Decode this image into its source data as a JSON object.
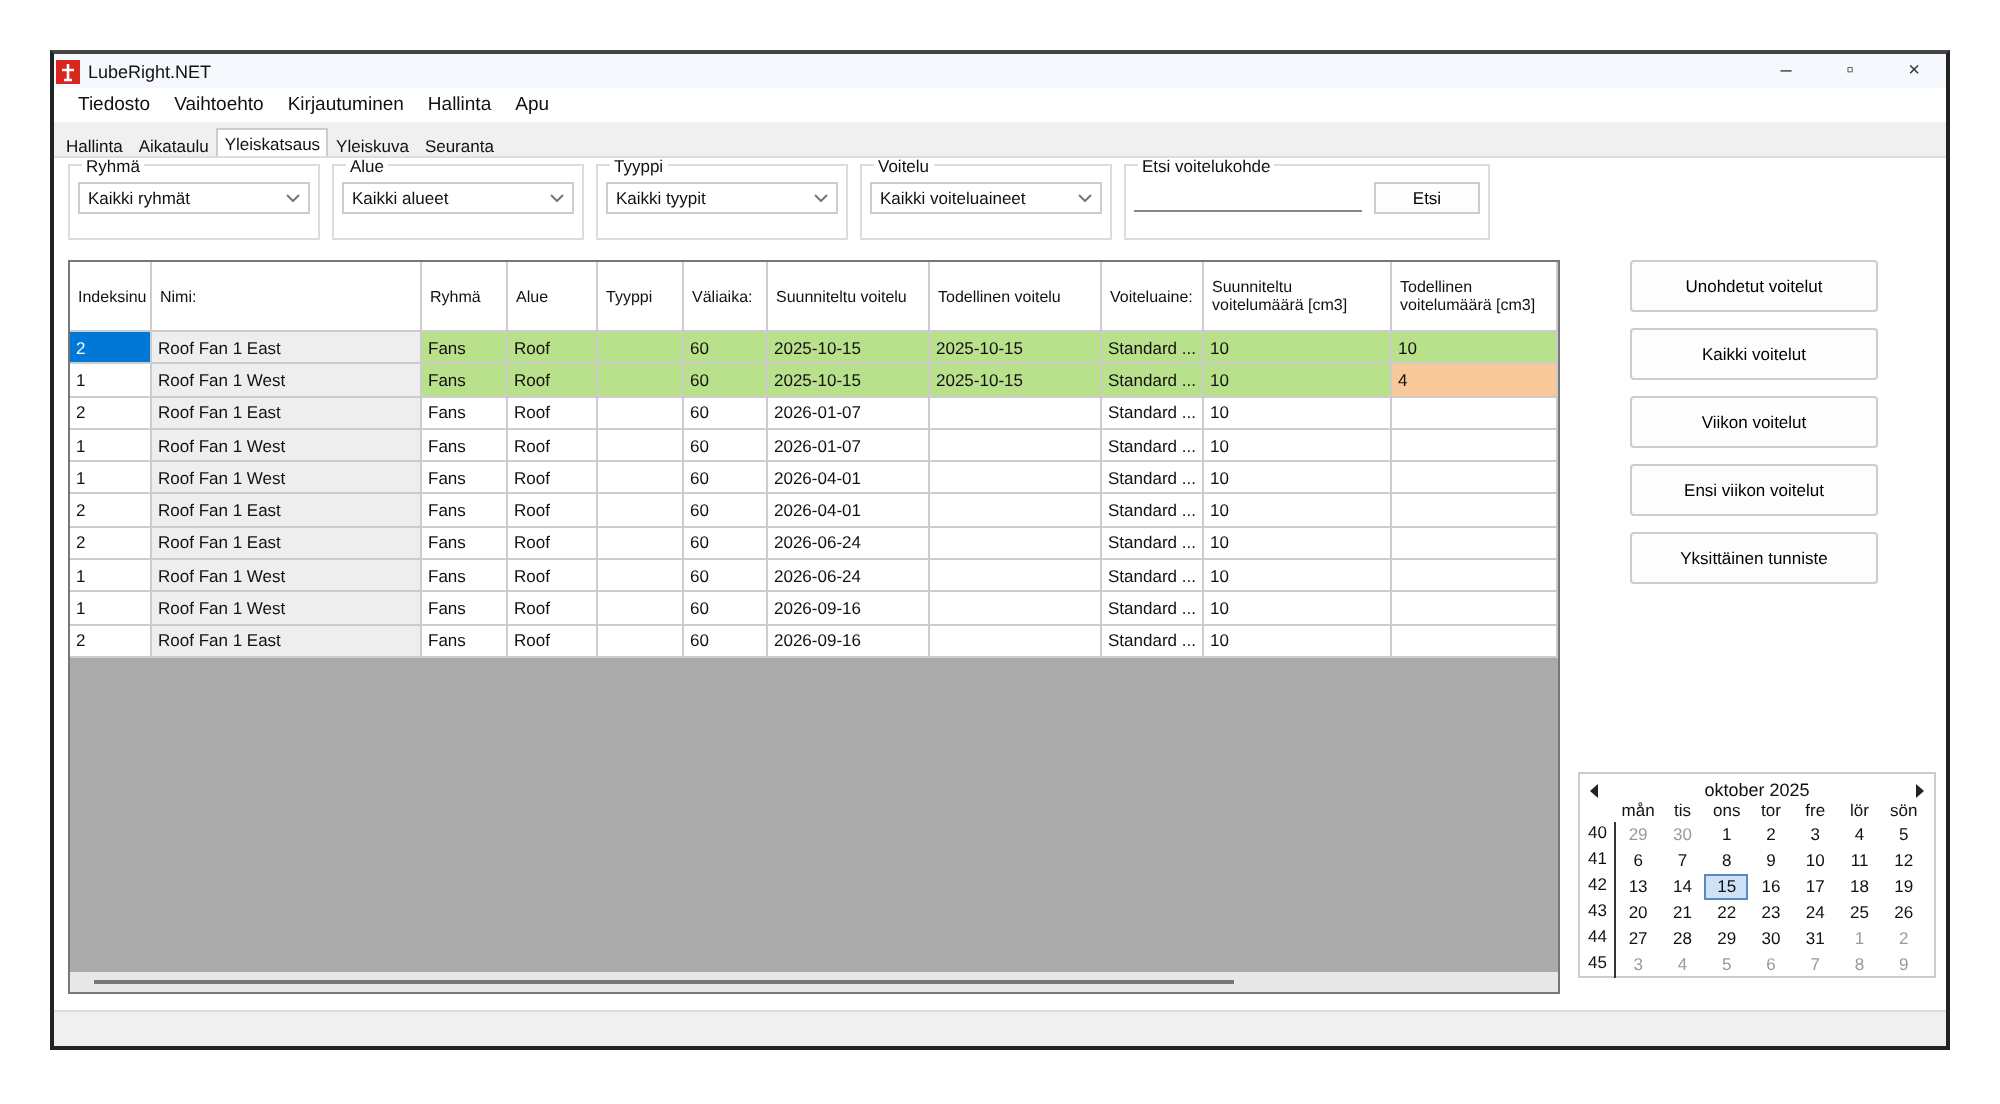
{
  "window": {
    "title": "LubeRight.NET",
    "controls": [
      "–",
      "▫",
      "×"
    ]
  },
  "menu": [
    "Tiedosto",
    "Vaihtoehto",
    "Kirjautuminen",
    "Hallinta",
    "Apu"
  ],
  "tabs": [
    {
      "label": "Hallinta",
      "selected": false
    },
    {
      "label": "Aikataulu",
      "selected": false
    },
    {
      "label": "Yleiskatsaus",
      "selected": true
    },
    {
      "label": "Yleiskuva",
      "selected": false
    },
    {
      "label": "Seuranta",
      "selected": false
    }
  ],
  "filters": [
    {
      "label": "Ryhmä",
      "value": "Kaikki ryhmät"
    },
    {
      "label": "Alue",
      "value": "Kaikki alueet"
    },
    {
      "label": "Tyyppi",
      "value": "Kaikki tyypit"
    },
    {
      "label": "Voitelu",
      "value": "Kaikki voiteluaineet"
    }
  ],
  "search": {
    "label": "Etsi voitelukohde",
    "button": "Etsi"
  },
  "table": {
    "columns": [
      "Indeksinu",
      "Nimi:",
      "Ryhmä",
      "Alue",
      "Tyyppi",
      "Väliaika:",
      "Suunniteltu voitelu",
      "Todellinen voitelu",
      "Voiteluaine:",
      "Suunniteltu voitelumäärä [cm3]",
      "Todellinen voitelumäärä [cm3]"
    ],
    "rows": [
      {
        "cells": [
          "2",
          "Roof Fan 1 East",
          "Fans",
          "Roof",
          "",
          "60",
          "2025-10-15",
          "2025-10-15",
          "Standard ...",
          "10",
          "10"
        ],
        "done": true,
        "amount_low": false,
        "selected": true
      },
      {
        "cells": [
          "1",
          "Roof Fan 1 West",
          "Fans",
          "Roof",
          "",
          "60",
          "2025-10-15",
          "2025-10-15",
          "Standard ...",
          "10",
          "4"
        ],
        "done": true,
        "amount_low": true,
        "selected": false
      },
      {
        "cells": [
          "2",
          "Roof Fan 1 East",
          "Fans",
          "Roof",
          "",
          "60",
          "2026-01-07",
          "",
          "Standard ...",
          "10",
          ""
        ],
        "done": false,
        "amount_low": false,
        "selected": false
      },
      {
        "cells": [
          "1",
          "Roof Fan 1 West",
          "Fans",
          "Roof",
          "",
          "60",
          "2026-01-07",
          "",
          "Standard ...",
          "10",
          ""
        ],
        "done": false,
        "amount_low": false,
        "selected": false
      },
      {
        "cells": [
          "1",
          "Roof Fan 1 West",
          "Fans",
          "Roof",
          "",
          "60",
          "2026-04-01",
          "",
          "Standard ...",
          "10",
          ""
        ],
        "done": false,
        "amount_low": false,
        "selected": false
      },
      {
        "cells": [
          "2",
          "Roof Fan 1 East",
          "Fans",
          "Roof",
          "",
          "60",
          "2026-04-01",
          "",
          "Standard ...",
          "10",
          ""
        ],
        "done": false,
        "amount_low": false,
        "selected": false
      },
      {
        "cells": [
          "2",
          "Roof Fan 1 East",
          "Fans",
          "Roof",
          "",
          "60",
          "2026-06-24",
          "",
          "Standard ...",
          "10",
          ""
        ],
        "done": false,
        "amount_low": false,
        "selected": false
      },
      {
        "cells": [
          "1",
          "Roof Fan 1 West",
          "Fans",
          "Roof",
          "",
          "60",
          "2026-06-24",
          "",
          "Standard ...",
          "10",
          ""
        ],
        "done": false,
        "amount_low": false,
        "selected": false
      },
      {
        "cells": [
          "1",
          "Roof Fan 1 West",
          "Fans",
          "Roof",
          "",
          "60",
          "2026-09-16",
          "",
          "Standard ...",
          "10",
          ""
        ],
        "done": false,
        "amount_low": false,
        "selected": false
      },
      {
        "cells": [
          "2",
          "Roof Fan 1 East",
          "Fans",
          "Roof",
          "",
          "60",
          "2026-09-16",
          "",
          "Standard ...",
          "10",
          ""
        ],
        "done": false,
        "amount_low": false,
        "selected": false
      }
    ]
  },
  "actions": [
    "Unohdetut voitelut",
    "Kaikki voitelut",
    "Viikon voitelut",
    "Ensi viikon voitelut",
    "Yksittäinen tunniste"
  ],
  "calendar": {
    "month": "oktober 2025",
    "weekdays": [
      "mån",
      "tis",
      "ons",
      "tor",
      "fre",
      "lör",
      "sön"
    ],
    "weeks": [
      {
        "week": "40",
        "days": [
          {
            "d": "29",
            "other": true,
            "selected": false
          },
          {
            "d": "30",
            "other": true,
            "selected": false
          },
          {
            "d": "1",
            "other": false,
            "selected": false
          },
          {
            "d": "2",
            "other": false,
            "selected": false
          },
          {
            "d": "3",
            "other": false,
            "selected": false
          },
          {
            "d": "4",
            "other": false,
            "selected": false
          },
          {
            "d": "5",
            "other": false,
            "selected": false
          }
        ]
      },
      {
        "week": "41",
        "days": [
          {
            "d": "6",
            "other": false,
            "selected": false
          },
          {
            "d": "7",
            "other": false,
            "selected": false
          },
          {
            "d": "8",
            "other": false,
            "selected": false
          },
          {
            "d": "9",
            "other": false,
            "selected": false
          },
          {
            "d": "10",
            "other": false,
            "selected": false
          },
          {
            "d": "11",
            "other": false,
            "selected": false
          },
          {
            "d": "12",
            "other": false,
            "selected": false
          }
        ]
      },
      {
        "week": "42",
        "days": [
          {
            "d": "13",
            "other": false,
            "selected": false
          },
          {
            "d": "14",
            "other": false,
            "selected": false
          },
          {
            "d": "15",
            "other": false,
            "selected": true
          },
          {
            "d": "16",
            "other": false,
            "selected": false
          },
          {
            "d": "17",
            "other": false,
            "selected": false
          },
          {
            "d": "18",
            "other": false,
            "selected": false
          },
          {
            "d": "19",
            "other": false,
            "selected": false
          }
        ]
      },
      {
        "week": "43",
        "days": [
          {
            "d": "20",
            "other": false,
            "selected": false
          },
          {
            "d": "21",
            "other": false,
            "selected": false
          },
          {
            "d": "22",
            "other": false,
            "selected": false
          },
          {
            "d": "23",
            "other": false,
            "selected": false
          },
          {
            "d": "24",
            "other": false,
            "selected": false
          },
          {
            "d": "25",
            "other": false,
            "selected": false
          },
          {
            "d": "26",
            "other": false,
            "selected": false
          }
        ]
      },
      {
        "week": "44",
        "days": [
          {
            "d": "27",
            "other": false,
            "selected": false
          },
          {
            "d": "28",
            "other": false,
            "selected": false
          },
          {
            "d": "29",
            "other": false,
            "selected": false
          },
          {
            "d": "30",
            "other": false,
            "selected": false
          },
          {
            "d": "31",
            "other": false,
            "selected": false
          },
          {
            "d": "1",
            "other": true,
            "selected": false
          },
          {
            "d": "2",
            "other": true,
            "selected": false
          }
        ]
      },
      {
        "week": "45",
        "days": [
          {
            "d": "3",
            "other": true,
            "selected": false
          },
          {
            "d": "4",
            "other": true,
            "selected": false
          },
          {
            "d": "5",
            "other": true,
            "selected": false
          },
          {
            "d": "6",
            "other": true,
            "selected": false
          },
          {
            "d": "7",
            "other": true,
            "selected": false
          },
          {
            "d": "8",
            "other": true,
            "selected": false
          },
          {
            "d": "9",
            "other": true,
            "selected": false
          }
        ]
      }
    ]
  }
}
